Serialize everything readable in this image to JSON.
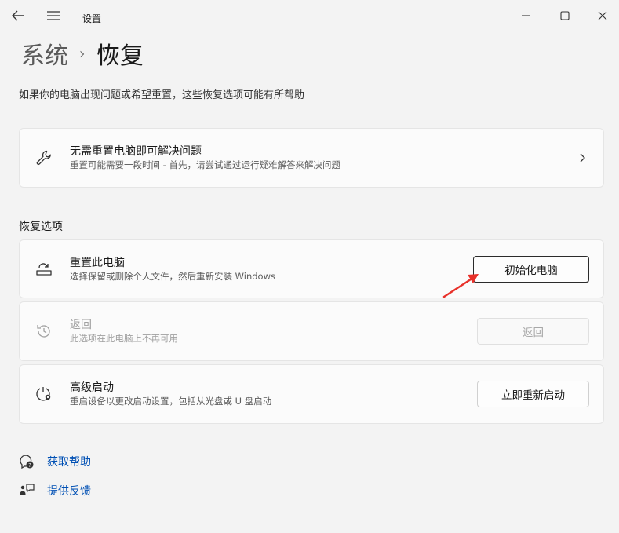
{
  "app": {
    "title": "设置"
  },
  "breadcrumb": {
    "parent": "系统",
    "separator": "›",
    "current": "恢复"
  },
  "description": "如果你的电脑出现问题或希望重置，这些恢复选项可能有所帮助",
  "troubleshoot": {
    "title": "无需重置电脑即可解决问题",
    "subtitle": "重置可能需要一段时间 - 首先，请尝试通过运行疑难解答来解决问题"
  },
  "section_title": "恢复选项",
  "options": [
    {
      "title": "重置此电脑",
      "subtitle": "选择保留或删除个人文件，然后重新安装 Windows",
      "button": "初始化电脑"
    },
    {
      "title": "返回",
      "subtitle": "此选项在此电脑上不再可用",
      "button": "返回"
    },
    {
      "title": "高级启动",
      "subtitle": "重启设备以更改启动设置，包括从光盘或 U 盘启动",
      "button": "立即重新启动"
    }
  ],
  "links": {
    "help": "获取帮助",
    "feedback": "提供反馈"
  },
  "colors": {
    "link": "#0050b4",
    "annotation_arrow": "#e8312a"
  }
}
